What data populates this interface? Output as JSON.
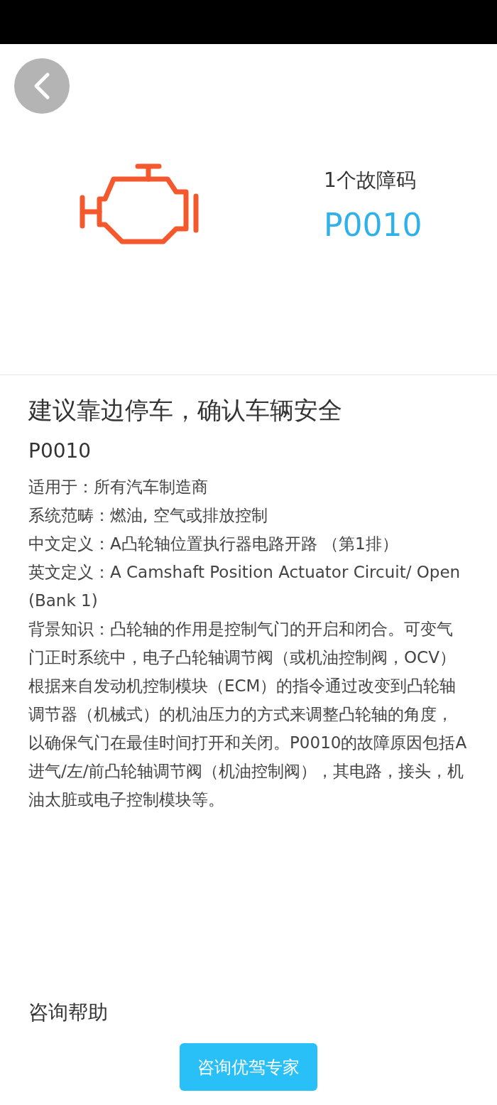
{
  "header": {
    "fault_count": "1个故障码",
    "fault_code": "P0010"
  },
  "advice": "建议靠边停车，确认车辆安全",
  "code": "P0010",
  "details": [
    "适用于：所有汽车制造商",
    "系统范畴：燃油, 空气或排放控制",
    "中文定义：A凸轮轴位置执行器电路开路 （第1排）",
    "英文定义：A Camshaft Position Actuator Circuit/ Open (Bank 1)",
    "背景知识：凸轮轴的作用是控制气门的开启和闭合。可变气门正时系统中，电子凸轮轴调节阀（或机油控制阀，OCV）根据来自发动机控制模块（ECM）的指令通过改变到凸轮轴调节器（机械式）的机油压力的方式来调整凸轮轴的角度，以确保气门在最佳时间打开和关闭。P0010的故障原因包括A进气/左/前凸轮轴调节阀（机油控制阀），其电路，接头，机油太脏或电子控制模块等。"
  ],
  "help": {
    "heading": "咨询帮助",
    "button": "咨询优驾专家"
  }
}
